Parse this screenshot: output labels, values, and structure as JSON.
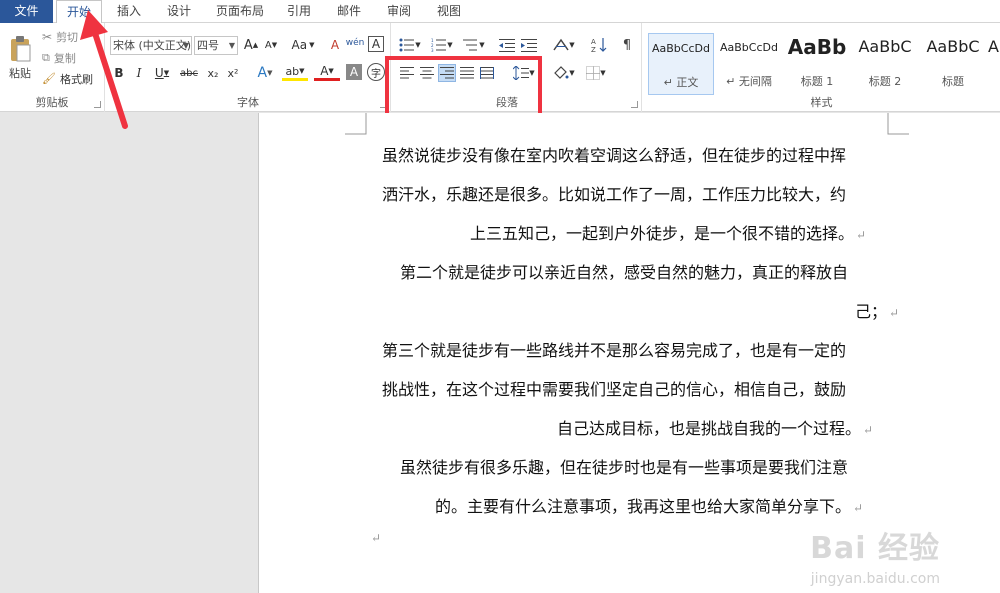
{
  "tabs": [
    "文件",
    "开始",
    "插入",
    "设计",
    "页面布局",
    "引用",
    "邮件",
    "审阅",
    "视图"
  ],
  "clipboard": {
    "paste": "粘贴",
    "cut": "剪切",
    "copy": "复制",
    "format_painter": "格式刷",
    "label": "剪贴板"
  },
  "font": {
    "name": "宋体 (中文正文)",
    "size": "四号",
    "grow": "A",
    "shrink": "A",
    "case": "Aa",
    "clear": "A",
    "phonetic": "wén",
    "border_char": "A",
    "bold": "B",
    "italic": "I",
    "underline": "U",
    "strike": "abc",
    "sub": "x₂",
    "sup": "x²",
    "effects": "A",
    "highlight": "ab",
    "color": "A",
    "shade": "A",
    "circle": "字",
    "label": "字体"
  },
  "paragraph": {
    "label": "段落"
  },
  "styles": {
    "items": [
      {
        "sample": "AaBbCcDd",
        "name": "↵ 正文"
      },
      {
        "sample": "AaBbCcDd",
        "name": "↵ 无间隔"
      },
      {
        "sample": "AaBb",
        "name": "标题 1"
      },
      {
        "sample": "AaBbC",
        "name": "标题 2"
      },
      {
        "sample": "AaBbC",
        "name": "标题"
      },
      {
        "sample": "A",
        "name": ""
      }
    ],
    "label": "样式"
  },
  "document": {
    "lines": [
      {
        "text": "虽然说徒步没有像在室内吹着空调这么舒适，但在徒步的过程中挥",
        "mark": ""
      },
      {
        "text": "洒汗水，乐趣还是很多。比如说工作了一周，工作压力比较大，约",
        "mark": ""
      },
      {
        "text": "上三五知己，一起到户外徒步，是一个很不错的选择。",
        "mark": "↵"
      },
      {
        "text": "第二个就是徒步可以亲近自然，感受自然的魅力，真正的释放自",
        "mark": ""
      },
      {
        "text": "己；",
        "mark": "↵"
      },
      {
        "text": "第三个就是徒步有一些路线并不是那么容易完成了，也是有一定的",
        "mark": ""
      },
      {
        "text": "挑战性，在这个过程中需要我们坚定自己的信心，相信自己，鼓励",
        "mark": ""
      },
      {
        "text": "自己达成目标，也是挑战自我的一个过程。",
        "mark": "↵"
      },
      {
        "text": "虽然徒步有很多乐趣，但在徒步时也是有一些事项是要我们注意",
        "mark": ""
      },
      {
        "text": "的。主要有什么注意事项，我再这里也给大家简单分享下。",
        "mark": "↵"
      },
      {
        "text": "",
        "mark": "↵"
      }
    ]
  },
  "watermark": {
    "brand": "Bai 经验",
    "url": "jingyan.baidu.com"
  }
}
